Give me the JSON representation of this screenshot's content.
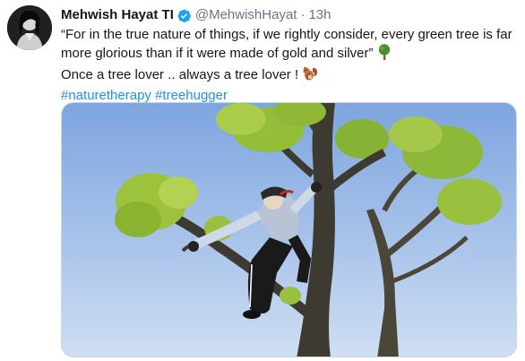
{
  "tweet": {
    "author": {
      "display_name": "Mehwish Hayat TI",
      "handle": "@MehwishHayat",
      "verified": true,
      "avatar_icon": "profile-photo"
    },
    "separator": "·",
    "time": "13h",
    "text_lines": [
      "“For in the true nature of things, if we rightly consider, every green tree is far",
      "more glorious than if it were made of gold and silver”",
      "Once a tree lover .. always a tree lover !"
    ],
    "emojis": [
      "deciduous-tree-emoji",
      "chipmunk-emoji"
    ],
    "hashtags": [
      "#naturetherapy",
      "#treehugger"
    ],
    "media": {
      "type": "photo",
      "icon": "person-climbing-tree-photo"
    }
  },
  "colors": {
    "text": "#14171a",
    "secondary": "#657786",
    "link": "#1b95e0",
    "verified": "#1da1f2",
    "border": "#ccd6dd"
  }
}
